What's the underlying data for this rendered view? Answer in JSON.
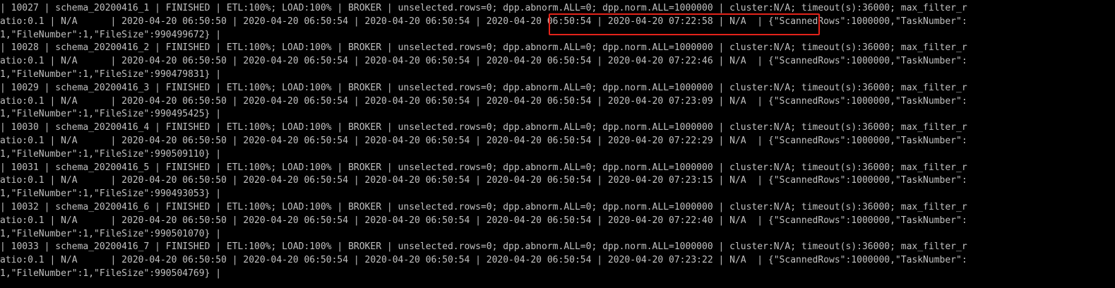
{
  "terminal": {
    "lines": [
      "| 10027 | schema_20200416_1 | FINISHED | ETL:100%; LOAD:100% | BROKER | unselected.rows=0; dpp.abnorm.ALL=0; dpp.norm.ALL=1000000 | cluster:N/A; timeout(s):36000; max_filter_r",
      "atio:0.1 | N/A      | 2020-04-20 06:50:50 | 2020-04-20 06:50:54 | 2020-04-20 06:50:54 | 2020-04-20 06:50:54 | 2020-04-20 07:22:58 | N/A  | {\"ScannedRows\":1000000,\"TaskNumber\":",
      "1,\"FileNumber\":1,\"FileSize\":990499672} |",
      "| 10028 | schema_20200416_2 | FINISHED | ETL:100%; LOAD:100% | BROKER | unselected.rows=0; dpp.abnorm.ALL=0; dpp.norm.ALL=1000000 | cluster:N/A; timeout(s):36000; max_filter_r",
      "atio:0.1 | N/A      | 2020-04-20 06:50:50 | 2020-04-20 06:50:54 | 2020-04-20 06:50:54 | 2020-04-20 06:50:54 | 2020-04-20 07:22:46 | N/A  | {\"ScannedRows\":1000000,\"TaskNumber\":",
      "1,\"FileNumber\":1,\"FileSize\":990479831} |",
      "| 10029 | schema_20200416_3 | FINISHED | ETL:100%; LOAD:100% | BROKER | unselected.rows=0; dpp.abnorm.ALL=0; dpp.norm.ALL=1000000 | cluster:N/A; timeout(s):36000; max_filter_r",
      "atio:0.1 | N/A      | 2020-04-20 06:50:50 | 2020-04-20 06:50:54 | 2020-04-20 06:50:54 | 2020-04-20 06:50:54 | 2020-04-20 07:23:09 | N/A  | {\"ScannedRows\":1000000,\"TaskNumber\":",
      "1,\"FileNumber\":1,\"FileSize\":990495425} |",
      "| 10030 | schema_20200416_4 | FINISHED | ETL:100%; LOAD:100% | BROKER | unselected.rows=0; dpp.abnorm.ALL=0; dpp.norm.ALL=1000000 | cluster:N/A; timeout(s):36000; max_filter_r",
      "atio:0.1 | N/A      | 2020-04-20 06:50:50 | 2020-04-20 06:50:54 | 2020-04-20 06:50:54 | 2020-04-20 06:50:54 | 2020-04-20 07:22:29 | N/A  | {\"ScannedRows\":1000000,\"TaskNumber\":",
      "1,\"FileNumber\":1,\"FileSize\":990509110} |",
      "| 10031 | schema_20200416_5 | FINISHED | ETL:100%; LOAD:100% | BROKER | unselected.rows=0; dpp.abnorm.ALL=0; dpp.norm.ALL=1000000 | cluster:N/A; timeout(s):36000; max_filter_r",
      "atio:0.1 | N/A      | 2020-04-20 06:50:50 | 2020-04-20 06:50:54 | 2020-04-20 06:50:54 | 2020-04-20 06:50:54 | 2020-04-20 07:23:15 | N/A  | {\"ScannedRows\":1000000,\"TaskNumber\":",
      "1,\"FileNumber\":1,\"FileSize\":990493053} |",
      "| 10032 | schema_20200416_6 | FINISHED | ETL:100%; LOAD:100% | BROKER | unselected.rows=0; dpp.abnorm.ALL=0; dpp.norm.ALL=1000000 | cluster:N/A; timeout(s):36000; max_filter_r",
      "atio:0.1 | N/A      | 2020-04-20 06:50:50 | 2020-04-20 06:50:54 | 2020-04-20 06:50:54 | 2020-04-20 06:50:54 | 2020-04-20 07:22:40 | N/A  | {\"ScannedRows\":1000000,\"TaskNumber\":",
      "1,\"FileNumber\":1,\"FileSize\":990501070} |",
      "| 10033 | schema_20200416_7 | FINISHED | ETL:100%; LOAD:100% | BROKER | unselected.rows=0; dpp.abnorm.ALL=0; dpp.norm.ALL=1000000 | cluster:N/A; timeout(s):36000; max_filter_r",
      "atio:0.1 | N/A      | 2020-04-20 06:50:50 | 2020-04-20 06:50:54 | 2020-04-20 06:50:54 | 2020-04-20 06:50:54 | 2020-04-20 07:23:22 | N/A  | {\"ScannedRows\":1000000,\"TaskNumber\":",
      "1,\"FileNumber\":1,\"FileSize\":990504769} |"
    ]
  },
  "colors": {
    "background": "#000000",
    "text": "#c0c0c0",
    "highlight_border": "#e2231a"
  }
}
